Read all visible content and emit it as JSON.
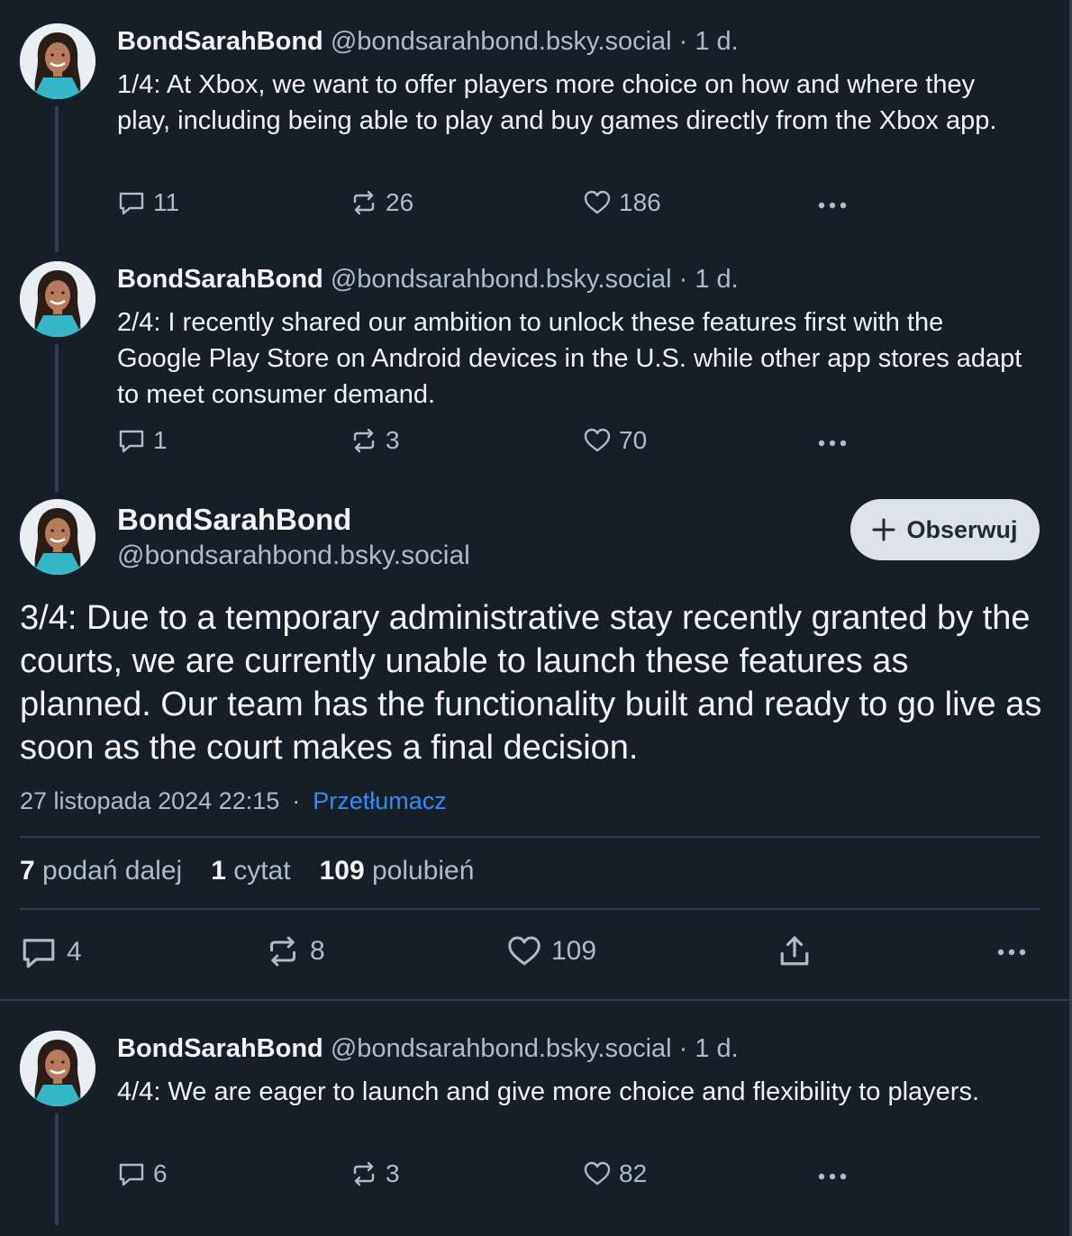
{
  "posts": [
    {
      "name": "BondSarahBond",
      "handle": "@bondsarahbond.bsky.social",
      "age": "· 1 d.",
      "text": "1/4: At Xbox, we want to offer players more choice on how and where they play, including being able to play and buy games directly from the Xbox app.",
      "replies": "11",
      "reposts": "26",
      "likes": "186"
    },
    {
      "name": "BondSarahBond",
      "handle": "@bondsarahbond.bsky.social",
      "age": "· 1 d.",
      "text": "2/4: I recently shared our ambition to unlock these features first with the Google Play Store on Android devices in the U.S. while other app stores adapt to meet consumer demand.",
      "replies": "1",
      "reposts": "3",
      "likes": "70"
    }
  ],
  "main_post": {
    "name": "BondSarahBond",
    "handle": "@bondsarahbond.bsky.social",
    "follow_label": "Obserwuj",
    "text": "3/4: Due to a temporary administrative stay recently granted by the courts, we are currently unable to launch these features as planned. Our team has the functionality built and ready to go live as soon as the court makes a final decision.",
    "timestamp": "27 listopada 2024 22:15",
    "separator": "·",
    "translate_label": "Przetłumacz",
    "stats": {
      "reposts_count": "7",
      "reposts_label": "podań dalej",
      "quotes_count": "1",
      "quotes_label": "cytat",
      "likes_count": "109",
      "likes_label": "polubień"
    },
    "replies": "4",
    "reposts": "8",
    "likes": "109"
  },
  "next_post": {
    "name": "BondSarahBond",
    "handle": "@bondsarahbond.bsky.social",
    "age": "· 1 d.",
    "text": "4/4: We are eager to launch and give more choice and flexibility to players.",
    "replies": "6",
    "reposts": "3",
    "likes": "82"
  },
  "icons": {
    "reply": "reply-icon",
    "repost": "repost-icon",
    "like": "heart-icon",
    "share": "share-icon",
    "more": "more-icon",
    "follow": "plus-icon"
  },
  "colors": {
    "background": "#161e27",
    "text": "#f1f3f5",
    "secondary": "#aebbc9",
    "link": "#2f8df5",
    "divider": "#2e4052",
    "follow_button": "#dce2e9"
  }
}
